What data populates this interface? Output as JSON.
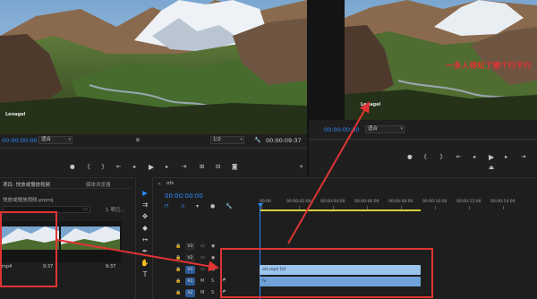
{
  "source_monitor": {
    "timecode_in": "00:00:00:00",
    "fit_select": "适合",
    "resolution_select": "1/2",
    "timecode_out": "00:00:09:37",
    "watermark": "Lenagel"
  },
  "program_monitor": {
    "timecode": "00:00:00:00",
    "fit_select": "适合",
    "overlay_text": "一条人得知了哪个行不行"
  },
  "project_panel": {
    "tab_project": "项目: 快放或慢放视频",
    "tab_media": "媒体浏览器",
    "file_name": "快放或慢放视频.prproj",
    "item_count": "1 项已...",
    "clips": [
      {
        "label": "mp4",
        "duration": "9:37"
      },
      {
        "label": "",
        "duration": "9:37"
      }
    ]
  },
  "timeline": {
    "sequence_tab": "ofs",
    "timecode": "00:00:00:00",
    "ruler_ticks": [
      "00:00",
      "00:00:02:00",
      "00:00:04:00",
      "00:00:06:00",
      "00:00:08:00",
      "00:00:10:00",
      "00:00:12:00",
      "00:00:14:00",
      "00:00:16:00"
    ],
    "tracks": {
      "v3": "V3",
      "v2": "V2",
      "v1": "V1",
      "a1": "A1",
      "a2": "A2"
    },
    "video_clip_label": "ofs.mp4 [V]",
    "audio_clip_label": "fx"
  },
  "colors": {
    "accent": "#2d8cff",
    "annotation": "#e03434",
    "work_area": "#d7cf3c",
    "clip_video": "#9cc5ee",
    "clip_audio": "#6fa2d8"
  }
}
